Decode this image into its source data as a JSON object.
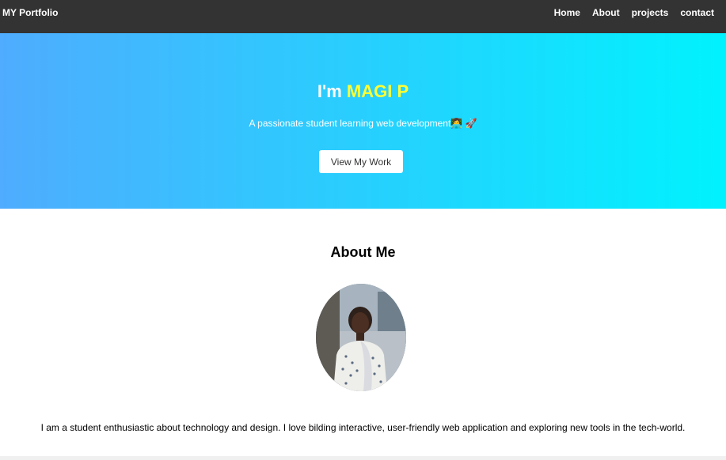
{
  "nav": {
    "brand": "MY Portfolio",
    "links": [
      "Home",
      "About",
      "projects",
      "contact"
    ]
  },
  "hero": {
    "greeting": "I'm ",
    "name": "MAGI P",
    "subtitle": "A passionate student learning web development👩‍💻 🚀",
    "button": "View My Work"
  },
  "about": {
    "title": "About Me",
    "text": "I am a student enthusiastic about technology and design. I love bilding interactive, user-friendly web application and exploring new tools in the tech-world."
  },
  "colors": {
    "navbar": "#333333",
    "hero_gradient_start": "#4facfe",
    "hero_gradient_end": "#00f2fe",
    "name_highlight": "#ffff33"
  }
}
